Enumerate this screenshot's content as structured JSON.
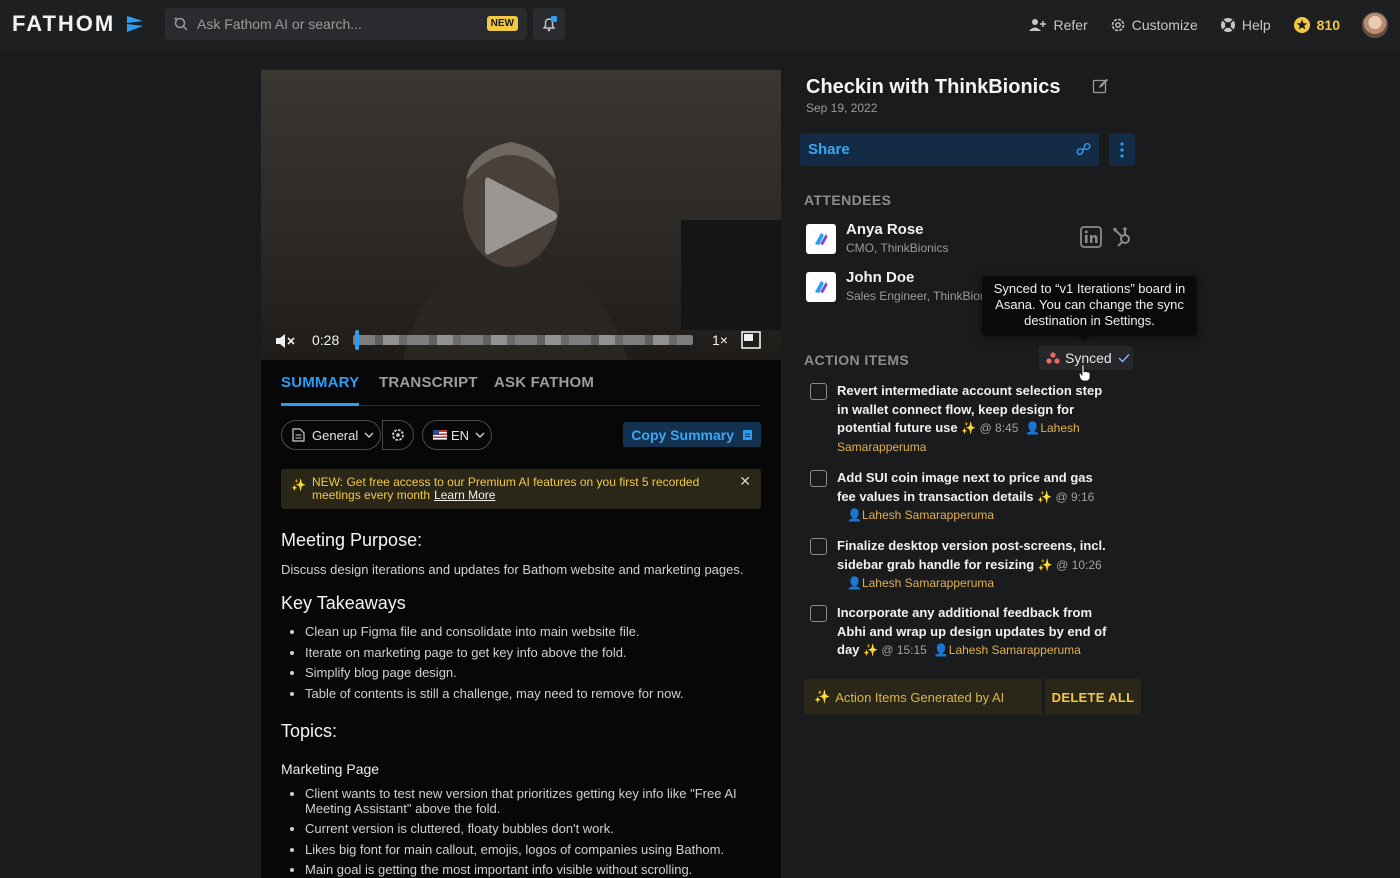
{
  "nav": {
    "logo": "FATHOM",
    "search_placeholder": "Ask Fathom AI or search...",
    "new_badge": "NEW",
    "refer": "Refer",
    "customize": "Customize",
    "help": "Help",
    "credits": "810"
  },
  "player": {
    "timecode": "0:28",
    "speed": "1×"
  },
  "tabs": [
    "SUMMARY",
    "TRANSCRIPT",
    "ASK FATHOM"
  ],
  "toolbar": {
    "template": "General",
    "language": "EN",
    "copy_label": "Copy Summary"
  },
  "notice": {
    "text": "NEW: Get free access to our Premium AI features on you first 5 recorded meetings every month",
    "link": "Learn More"
  },
  "summary": {
    "purpose_heading": "Meeting Purpose:",
    "purpose_text": "Discuss design iterations and updates for Bathom website and marketing pages.",
    "takeaways_heading": "Key Takeaways",
    "takeaways": [
      "Clean up Figma file and consolidate into main website file.",
      "Iterate on marketing page to get key info above the fold.",
      "Simplify blog page design.",
      "Table of contents is still a challenge, may need to remove for now."
    ],
    "topics_heading": "Topics:",
    "topic_title": "Marketing Page",
    "topic_points": [
      "Client wants to test new version that prioritizes getting key info like \"Free AI Meeting Assistant\" above the fold.",
      "Current version is cluttered, floaty bubbles don't work.",
      "Likes big font for main callout, emojis, logos of companies using Bathom.",
      "Main goal is getting the most important info visible without scrolling."
    ]
  },
  "meeting": {
    "title": "Checkin with ThinkBionics",
    "date": "Sep 19, 2022",
    "share_label": "Share"
  },
  "attendees_label": "ATTENDEES",
  "attendees": [
    {
      "name": "Anya Rose",
      "role": "CMO, ThinkBionics"
    },
    {
      "name": "John Doe",
      "role": "Sales Engineer, ThinkBior"
    }
  ],
  "tooltip": "Synced to “v1 Iterations” board in Asana. You can change the sync destination in Settings.",
  "action_items_label": "ACTION ITEMS",
  "synced_label": "Synced",
  "action_items": [
    {
      "text": "Revert intermediate account selection step in wallet connect flow, keep design for potential future use",
      "time": "@ 8:45",
      "assignee": "Lahesh Samarapperuma"
    },
    {
      "text": "Add SUI coin image next to price and gas fee values in transaction details",
      "time": "@ 9:16",
      "assignee": "Lahesh Samarapperuma"
    },
    {
      "text": "Finalize desktop version post-screens, incl. sidebar grab handle for resizing",
      "time": "@ 10:26",
      "assignee": "Lahesh Samarapperuma"
    },
    {
      "text": "Incorporate any additional feedback from Abhi and wrap up design updates by end of day",
      "time": "@ 15:15",
      "assignee": "Lahesh Samarapperuma"
    }
  ],
  "ai_generated_label": "Action Items Generated by AI",
  "delete_all_label": "DELETE ALL",
  "colors": {
    "accent": "#2a9df4",
    "warning": "#f5c842",
    "background": "#1a1b1d"
  }
}
